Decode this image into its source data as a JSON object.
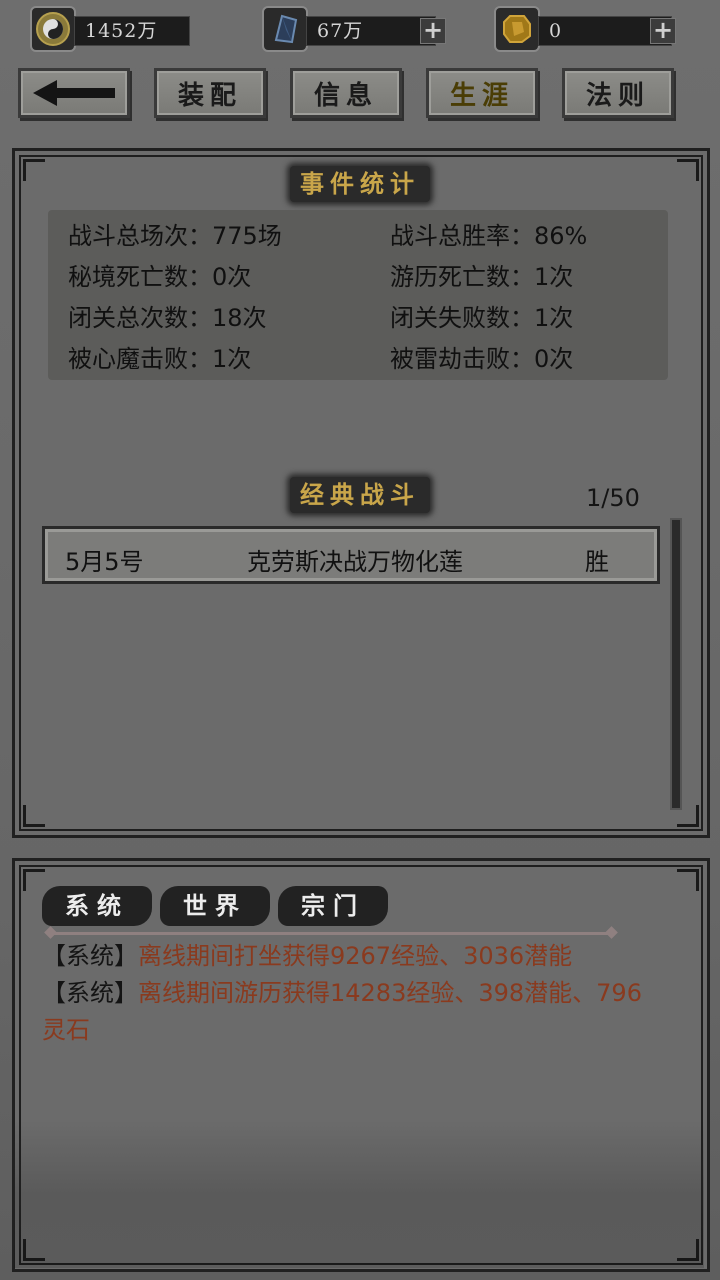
{
  "currency": {
    "coins": {
      "value": "1452万",
      "icon": "yin-yang-coin-icon"
    },
    "crystal": {
      "value": "67万",
      "icon": "blue-crystal-icon"
    },
    "gem": {
      "value": "0",
      "icon": "gold-gem-icon"
    }
  },
  "nav": {
    "back_icon": "back-arrow-icon",
    "tabs": [
      {
        "label": "装配"
      },
      {
        "label": "信息"
      },
      {
        "label": "生涯",
        "active": true
      },
      {
        "label": "法则"
      }
    ]
  },
  "events": {
    "title": "事件统计",
    "stats": [
      {
        "label": "战斗总场次：775场"
      },
      {
        "label": "战斗总胜率：86%"
      },
      {
        "label": "秘境死亡数：0次"
      },
      {
        "label": "游历死亡数：1次"
      },
      {
        "label": "闭关总次数：18次"
      },
      {
        "label": "闭关失败数：1次"
      },
      {
        "label": "被心魔击败：1次"
      },
      {
        "label": "被雷劫击败：0次"
      }
    ]
  },
  "battles": {
    "title": "经典战斗",
    "pager": "1/50",
    "rows": [
      {
        "date": "5月5号",
        "name": "克劳斯决战万物化莲",
        "result": "胜"
      }
    ]
  },
  "chat": {
    "tabs": [
      "系统",
      "世界",
      "宗门"
    ],
    "messages": [
      {
        "tag": "【系统】",
        "text": "离线期间打坐获得9267经验、3036潜能"
      },
      {
        "tag": "【系统】",
        "text": "离线期间游历获得14283经验、398潜能、796灵石"
      }
    ]
  },
  "colors": {
    "accent_gold": "#c9a64a",
    "message_red": "#8a3a1e"
  }
}
